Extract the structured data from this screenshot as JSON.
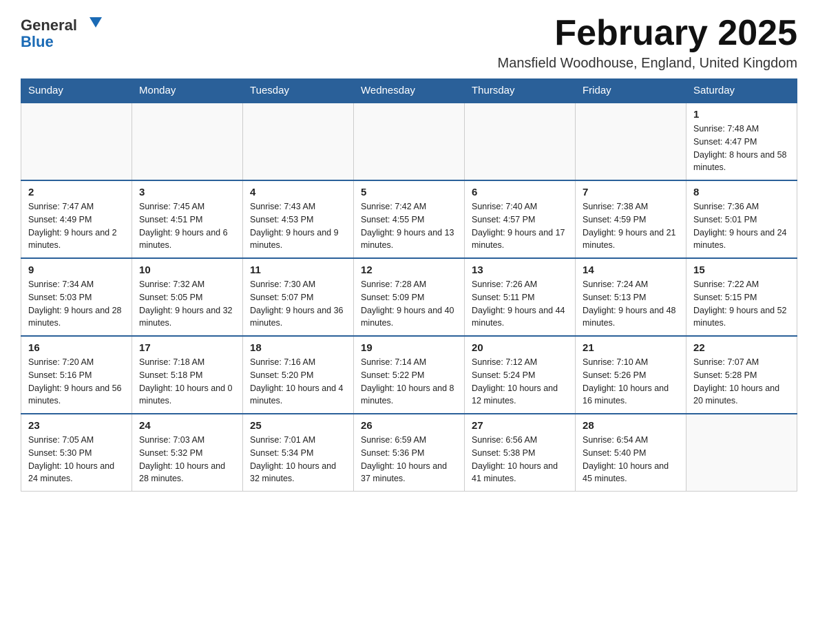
{
  "logo": {
    "text_general": "General",
    "text_blue": "Blue"
  },
  "header": {
    "month_title": "February 2025",
    "location": "Mansfield Woodhouse, England, United Kingdom"
  },
  "weekdays": [
    "Sunday",
    "Monday",
    "Tuesday",
    "Wednesday",
    "Thursday",
    "Friday",
    "Saturday"
  ],
  "weeks": [
    [
      {
        "day": "",
        "info": ""
      },
      {
        "day": "",
        "info": ""
      },
      {
        "day": "",
        "info": ""
      },
      {
        "day": "",
        "info": ""
      },
      {
        "day": "",
        "info": ""
      },
      {
        "day": "",
        "info": ""
      },
      {
        "day": "1",
        "info": "Sunrise: 7:48 AM\nSunset: 4:47 PM\nDaylight: 8 hours and 58 minutes."
      }
    ],
    [
      {
        "day": "2",
        "info": "Sunrise: 7:47 AM\nSunset: 4:49 PM\nDaylight: 9 hours and 2 minutes."
      },
      {
        "day": "3",
        "info": "Sunrise: 7:45 AM\nSunset: 4:51 PM\nDaylight: 9 hours and 6 minutes."
      },
      {
        "day": "4",
        "info": "Sunrise: 7:43 AM\nSunset: 4:53 PM\nDaylight: 9 hours and 9 minutes."
      },
      {
        "day": "5",
        "info": "Sunrise: 7:42 AM\nSunset: 4:55 PM\nDaylight: 9 hours and 13 minutes."
      },
      {
        "day": "6",
        "info": "Sunrise: 7:40 AM\nSunset: 4:57 PM\nDaylight: 9 hours and 17 minutes."
      },
      {
        "day": "7",
        "info": "Sunrise: 7:38 AM\nSunset: 4:59 PM\nDaylight: 9 hours and 21 minutes."
      },
      {
        "day": "8",
        "info": "Sunrise: 7:36 AM\nSunset: 5:01 PM\nDaylight: 9 hours and 24 minutes."
      }
    ],
    [
      {
        "day": "9",
        "info": "Sunrise: 7:34 AM\nSunset: 5:03 PM\nDaylight: 9 hours and 28 minutes."
      },
      {
        "day": "10",
        "info": "Sunrise: 7:32 AM\nSunset: 5:05 PM\nDaylight: 9 hours and 32 minutes."
      },
      {
        "day": "11",
        "info": "Sunrise: 7:30 AM\nSunset: 5:07 PM\nDaylight: 9 hours and 36 minutes."
      },
      {
        "day": "12",
        "info": "Sunrise: 7:28 AM\nSunset: 5:09 PM\nDaylight: 9 hours and 40 minutes."
      },
      {
        "day": "13",
        "info": "Sunrise: 7:26 AM\nSunset: 5:11 PM\nDaylight: 9 hours and 44 minutes."
      },
      {
        "day": "14",
        "info": "Sunrise: 7:24 AM\nSunset: 5:13 PM\nDaylight: 9 hours and 48 minutes."
      },
      {
        "day": "15",
        "info": "Sunrise: 7:22 AM\nSunset: 5:15 PM\nDaylight: 9 hours and 52 minutes."
      }
    ],
    [
      {
        "day": "16",
        "info": "Sunrise: 7:20 AM\nSunset: 5:16 PM\nDaylight: 9 hours and 56 minutes."
      },
      {
        "day": "17",
        "info": "Sunrise: 7:18 AM\nSunset: 5:18 PM\nDaylight: 10 hours and 0 minutes."
      },
      {
        "day": "18",
        "info": "Sunrise: 7:16 AM\nSunset: 5:20 PM\nDaylight: 10 hours and 4 minutes."
      },
      {
        "day": "19",
        "info": "Sunrise: 7:14 AM\nSunset: 5:22 PM\nDaylight: 10 hours and 8 minutes."
      },
      {
        "day": "20",
        "info": "Sunrise: 7:12 AM\nSunset: 5:24 PM\nDaylight: 10 hours and 12 minutes."
      },
      {
        "day": "21",
        "info": "Sunrise: 7:10 AM\nSunset: 5:26 PM\nDaylight: 10 hours and 16 minutes."
      },
      {
        "day": "22",
        "info": "Sunrise: 7:07 AM\nSunset: 5:28 PM\nDaylight: 10 hours and 20 minutes."
      }
    ],
    [
      {
        "day": "23",
        "info": "Sunrise: 7:05 AM\nSunset: 5:30 PM\nDaylight: 10 hours and 24 minutes."
      },
      {
        "day": "24",
        "info": "Sunrise: 7:03 AM\nSunset: 5:32 PM\nDaylight: 10 hours and 28 minutes."
      },
      {
        "day": "25",
        "info": "Sunrise: 7:01 AM\nSunset: 5:34 PM\nDaylight: 10 hours and 32 minutes."
      },
      {
        "day": "26",
        "info": "Sunrise: 6:59 AM\nSunset: 5:36 PM\nDaylight: 10 hours and 37 minutes."
      },
      {
        "day": "27",
        "info": "Sunrise: 6:56 AM\nSunset: 5:38 PM\nDaylight: 10 hours and 41 minutes."
      },
      {
        "day": "28",
        "info": "Sunrise: 6:54 AM\nSunset: 5:40 PM\nDaylight: 10 hours and 45 minutes."
      },
      {
        "day": "",
        "info": ""
      }
    ]
  ]
}
